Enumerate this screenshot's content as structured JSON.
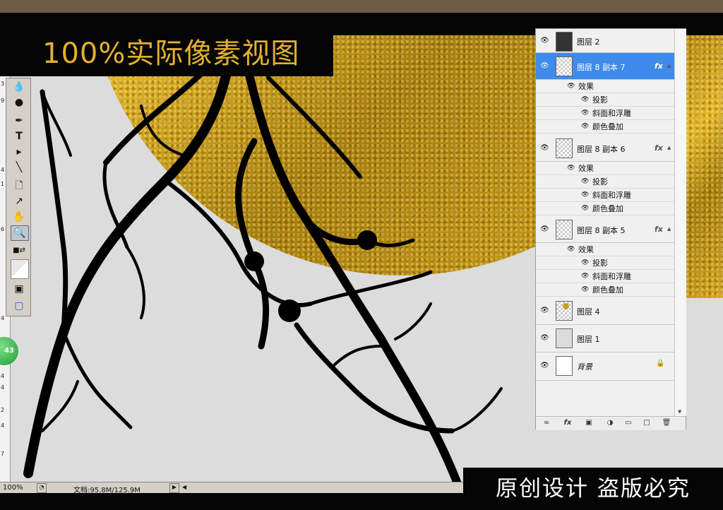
{
  "canvas": {
    "label": "100%实际像素视图"
  },
  "ruler": {
    "ticks": [
      "3",
      "9",
      "4",
      "1",
      "6",
      "4",
      "4",
      "4",
      "2",
      "4",
      "7"
    ]
  },
  "status_bar": {
    "zoom": "100%",
    "doc": "文档:95.8M/125.9M"
  },
  "badge": {
    "value": "43"
  },
  "layers_panel": {
    "layers": [
      {
        "name": "图层 2",
        "fx": false
      },
      {
        "name": "图层 8 副本 7",
        "fx": true,
        "selected": true,
        "effects_label": "效果",
        "effects": [
          "投影",
          "斜面和浮雕",
          "颜色叠加"
        ]
      },
      {
        "name": "图层 8 副本 6",
        "fx": true,
        "effects_label": "效果",
        "effects": [
          "投影",
          "斜面和浮雕",
          "颜色叠加"
        ]
      },
      {
        "name": "图层 8 副本 5",
        "fx": true,
        "effects_label": "效果",
        "effects": [
          "投影",
          "斜面和浮雕",
          "颜色叠加"
        ]
      },
      {
        "name": "图层 4",
        "fx": false
      },
      {
        "name": "图层 1",
        "fx": false
      },
      {
        "name": "背景",
        "fx": false,
        "locked": true
      }
    ],
    "fx_label": "fx"
  },
  "caption": "原创设计 盗版必究",
  "colors": {
    "gold": "#d4a520",
    "canvas_bg": "#dcdcdc",
    "selection": "#3d8bea",
    "label_text": "#e1b12e"
  }
}
